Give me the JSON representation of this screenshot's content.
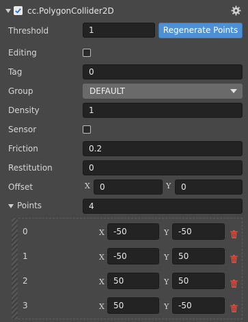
{
  "component": {
    "title": "cc.PolygonCollider2D",
    "enabled": true
  },
  "threshold": {
    "label": "Threshold",
    "value": "1"
  },
  "regenerate_button": {
    "label": "Regenerate Points"
  },
  "editing": {
    "label": "Editing",
    "checked": false
  },
  "tag": {
    "label": "Tag",
    "value": "0"
  },
  "group": {
    "label": "Group",
    "value": "DEFAULT"
  },
  "density": {
    "label": "Density",
    "value": "1"
  },
  "sensor": {
    "label": "Sensor",
    "checked": false
  },
  "friction": {
    "label": "Friction",
    "value": "0.2"
  },
  "restitution": {
    "label": "Restitution",
    "value": "0"
  },
  "offset": {
    "label": "Offset",
    "x_axis": "X",
    "y_axis": "Y",
    "x": "0",
    "y": "0"
  },
  "points": {
    "label": "Points",
    "count": "4",
    "x_axis": "X",
    "y_axis": "Y",
    "items": [
      {
        "index": "0",
        "x": "-50",
        "y": "-50"
      },
      {
        "index": "1",
        "x": "-50",
        "y": "50"
      },
      {
        "index": "2",
        "x": "50",
        "y": "50"
      },
      {
        "index": "3",
        "x": "50",
        "y": "-50"
      }
    ]
  },
  "colors": {
    "accent": "#4d90d6",
    "background": "#474747",
    "field": "#232323",
    "delete": "#d84a3c"
  },
  "icons": {
    "header_checkbox": "checkbox-checked-icon",
    "settings": "gear-icon",
    "delete": "trash-icon"
  }
}
